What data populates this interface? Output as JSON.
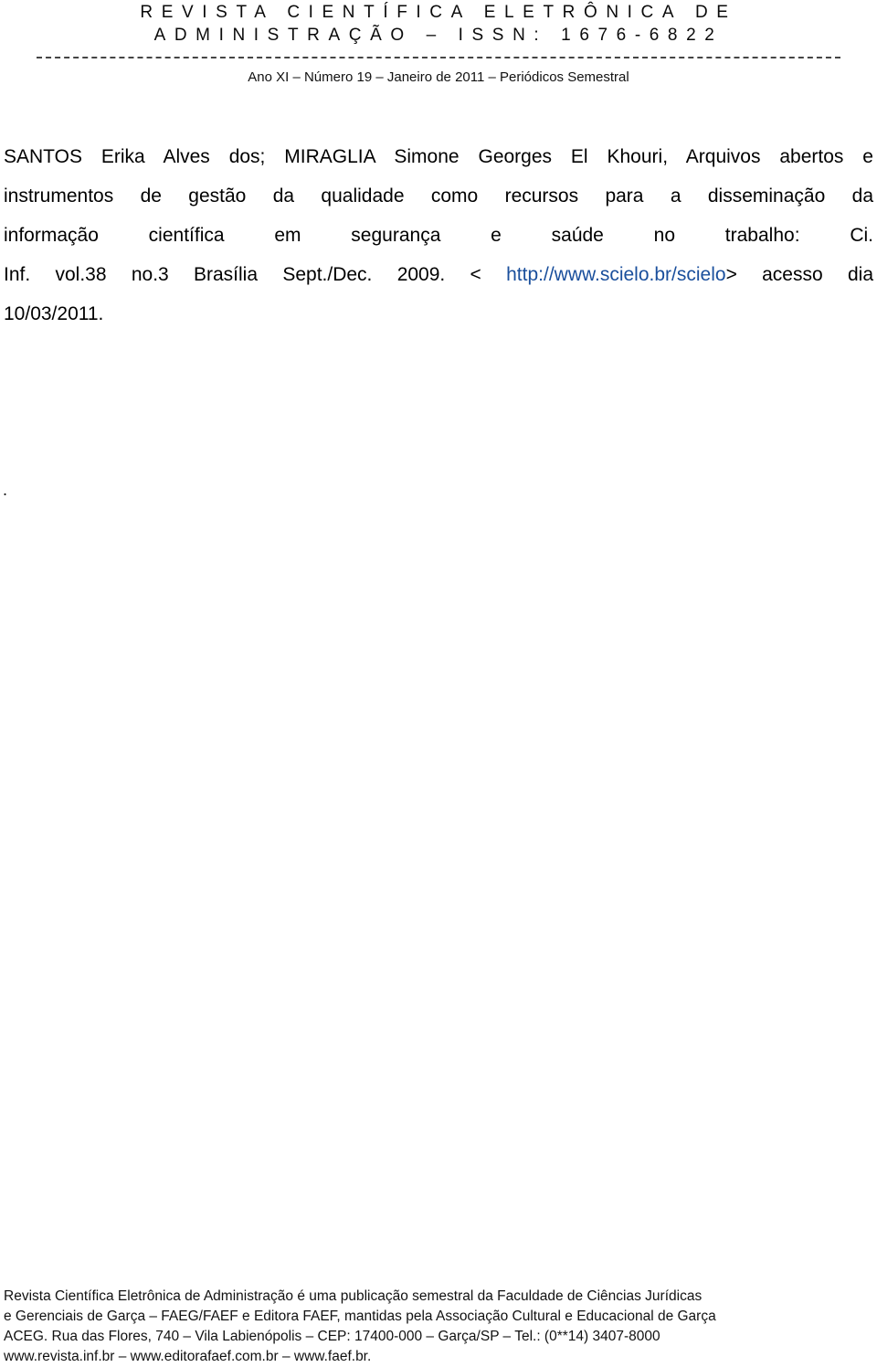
{
  "header": {
    "title_line1": "REVISTA CIENTÍFICA ELETRÔNICA DE",
    "title_line2": "ADMINISTRAÇÃO – ISSN: 1676-6822",
    "issue_line": "Ano XI – Número 19 – Janeiro de 2011 – Periódicos Semestral"
  },
  "reference": {
    "lines": [
      "SANTOS Erika Alves dos; MIRAGLIA Simone Georges El Khouri, Arquivos abertos e",
      "instrumentos de gestão da qualidade como recursos para a disseminação da",
      "informação científica em segurança e saúde no trabalho: Ci."
    ],
    "line4_before_link": "Inf. vol.38 no.3 Brasília Sept./Dec. 2009. < ",
    "link_text": "http://www.scielo.br/scielo",
    "line4_after_link": "> acesso dia",
    "line5": "10/03/2011.",
    "link_color": "#1a4f9c"
  },
  "stray_mark": ".",
  "footer": {
    "lines": [
      "Revista Científica Eletrônica de Administração é uma publicação semestral da Faculdade de Ciências Jurídicas",
      "e Gerenciais de Garça – FAEG/FAEF e Editora FAEF, mantidas pela Associação Cultural e Educacional de Garça",
      "ACEG. Rua das Flores, 740 – Vila Labienópolis – CEP: 17400-000 – Garça/SP – Tel.: (0**14) 3407-8000",
      "www.revista.inf.br – www.editorafaef.com.br – www.faef.br."
    ]
  }
}
